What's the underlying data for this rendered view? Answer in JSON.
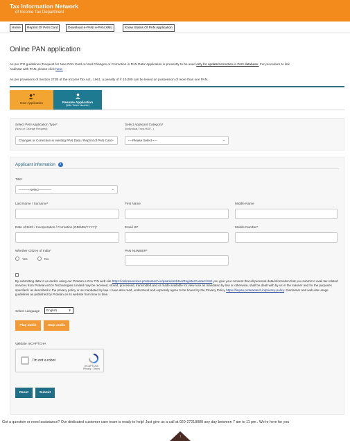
{
  "header": {
    "title": "Tax Information Network",
    "subtitle": "of Income Tax Department",
    "bg_color": "#f28a1c"
  },
  "nav": {
    "items": [
      {
        "label": "Home"
      },
      {
        "label": "Reprint Of PAN Card"
      },
      {
        "label": "Download e-PAN/ e-PAN XML"
      },
      {
        "label": "Know Status Of PAN Application"
      }
    ]
  },
  "page": {
    "title": "Online PAN application",
    "info_line1_a": "As per ITD guidelines,'Request for New PAN Card or/ and Changes or Correction in PAN Data' application is presently to be used",
    "info_line1_underlined": "only for update/correction in PAN database.",
    "info_line1_b": "For procedure to link",
    "info_line2_a": "Aadhaar with PAN, please click",
    "info_line2_link": "here.",
    "info_line3": "As per provisions of Section 272B of the Income Tax Act., 1961, a penalty of ₹ 10,000 can be levied on possession of more than one PAN."
  },
  "tabs": {
    "new": {
      "label": "New Application"
    },
    "resume": {
      "label": "Resume Application",
      "sub": "(With Token Number)"
    }
  },
  "application": {
    "type_label": "Select PAN Application Type*",
    "type_sub": "(New or Change Request)",
    "type_value": "Changes or Correction in existing PAN Data / Reprint of PAN Card",
    "category_label": "Select Applicant Category*",
    "category_sub": "(Individual,Trust,HUF,..)",
    "category_value": "----Please Select-----"
  },
  "applicant": {
    "section_title": "Applicant information",
    "title_label": "Title*",
    "title_value": "-----------select------------",
    "last_name_label": "Last Name / Surname*",
    "first_name_label": "First Name",
    "middle_name_label": "Middle Name",
    "dob_label": "Date of Birth / Incorporation / Formation (DD/MM/YYYY)*",
    "email_label": "Email ID*",
    "mobile_label": "Mobile Number*",
    "citizen_label": "Whether Citizen of India*",
    "yes_label": "Yes",
    "no_label": "No",
    "pan_label": "PAN NUMBER*"
  },
  "consent": {
    "text_a": "By submitting data to us and/or using our Protean e-Gov TIN web site",
    "link1": "https://onlineservices.proteantech.in/paam/endUserRegisterContact.html",
    "text_b": "you give your consent that all personal data/information that you submit to avail tax related services from Protean eGov Technologies Limited may be received, stored, processed, transmitted and or made available for view /use as mandated by law or otherwise, shall be dealt with by us in the manner and for the purposes specified / as described in the privacy policy or as mandated by law. I have also read, understood and expressly agree to be bound by the Privacy Policy",
    "link2": "https://tinpan.proteantech.in/privacy-policy",
    "text_c": ". Disclaimer and web-site usage guidelines as published by Protean on its website from time to time."
  },
  "language": {
    "label": "Select Language",
    "value": "English"
  },
  "audio": {
    "play": "Play audio",
    "stop": "Stop audio"
  },
  "captcha": {
    "label": "Validate reCAPTCHA",
    "checkbox_text": "I'm not a robot",
    "brand": "reCAPTCHA",
    "terms": "Privacy - Terms"
  },
  "actions": {
    "reset": "Reset",
    "submit": "Submit"
  },
  "footer": {
    "support": "Got a question or need assistance? Our dedicated customer care team is ready to help! Just give us a call at 020-27218080 any day between 7 am to 11 pm . We're here for you"
  }
}
